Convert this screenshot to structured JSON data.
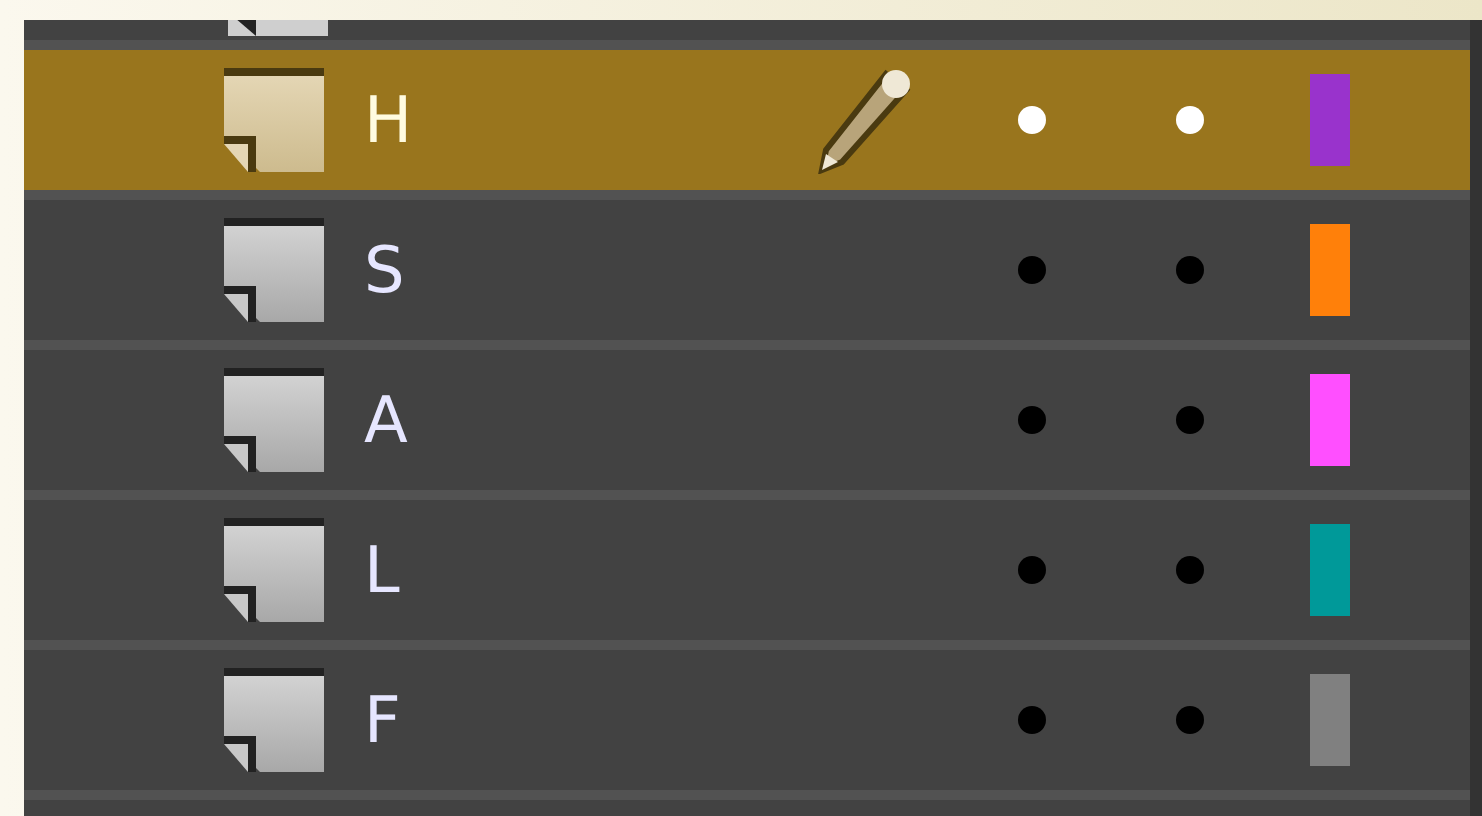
{
  "layers": [
    {
      "name": "H",
      "selected": true,
      "color": "#9933cc"
    },
    {
      "name": "S",
      "selected": false,
      "color": "#ff800a"
    },
    {
      "name": "A",
      "selected": false,
      "color": "#ff4fff"
    },
    {
      "name": "L",
      "selected": false,
      "color": "#009999"
    },
    {
      "name": "F",
      "selected": false,
      "color": "#808080"
    }
  ]
}
